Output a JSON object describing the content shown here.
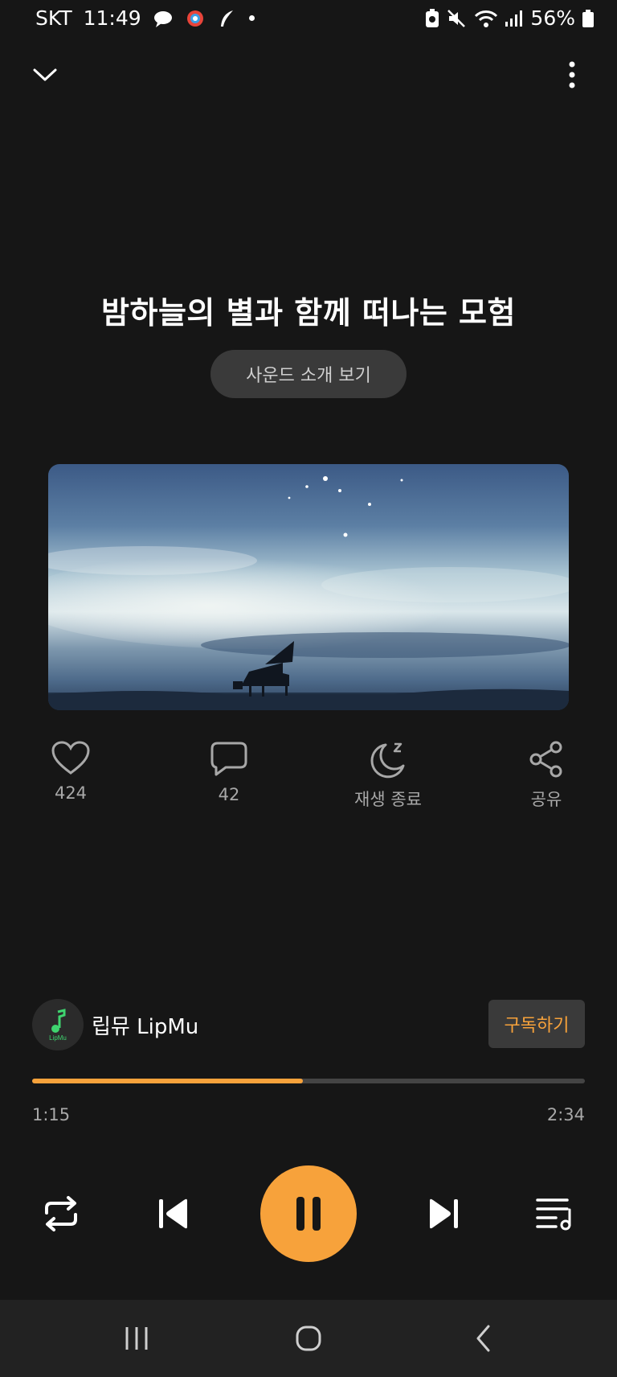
{
  "status_bar": {
    "carrier": "SKT",
    "time": "11:49",
    "battery": "56%"
  },
  "track": {
    "title": "밤하늘의 별과 함께 떠나는 모험",
    "intro_button": "사운드 소개 보기"
  },
  "actions": {
    "like_count": "424",
    "comment_count": "42",
    "sleep_timer_label": "재생 종료",
    "share_label": "공유"
  },
  "channel": {
    "name": "립뮤 LipMu",
    "avatar_text": "LipMu",
    "subscribe_label": "구독하기"
  },
  "playback": {
    "current_time": "1:15",
    "total_time": "2:34",
    "progress": 0.49
  },
  "colors": {
    "accent": "#f7a23b",
    "background": "#161616"
  }
}
